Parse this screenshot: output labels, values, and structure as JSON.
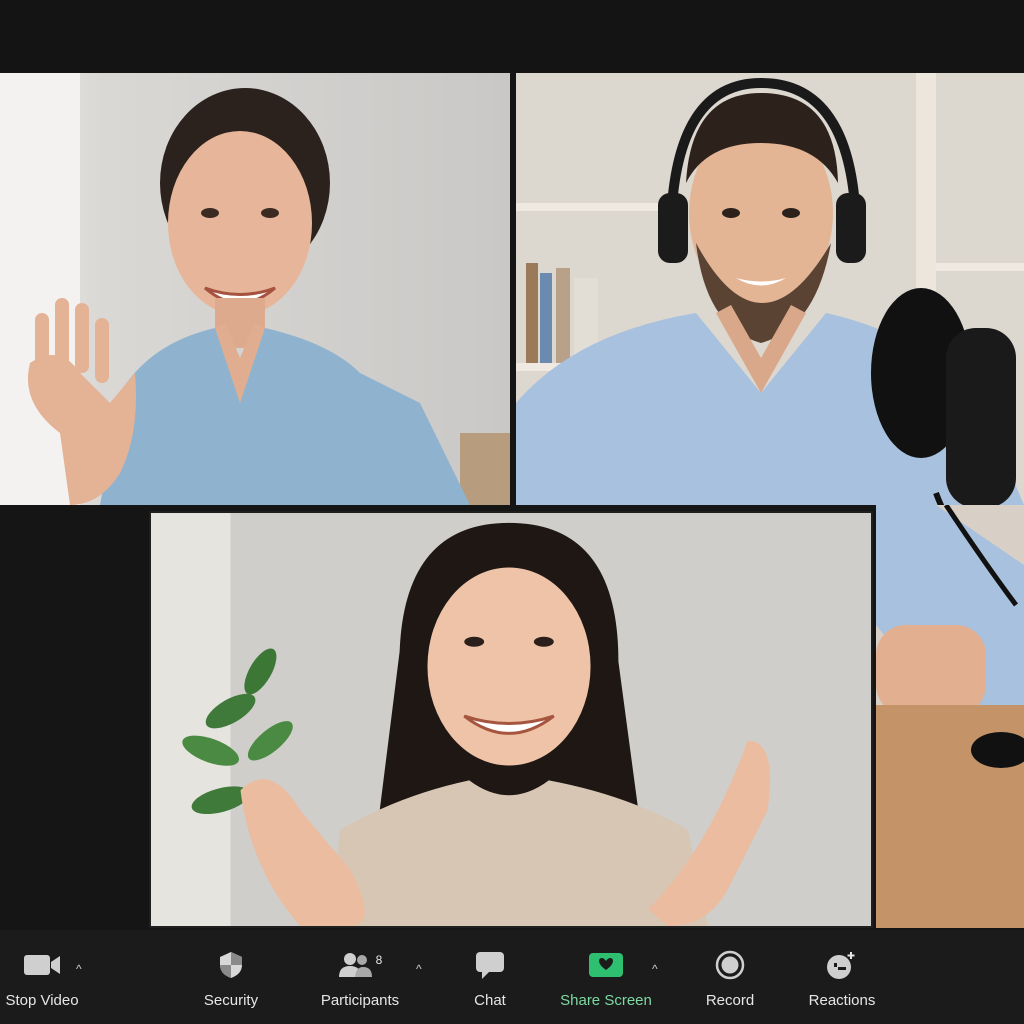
{
  "app": {
    "accent": "#2fbf71",
    "toolbar_bg": "#1b1b1b"
  },
  "participants": [
    {
      "tile": "top-left",
      "description": "woman waving, denim shirt"
    },
    {
      "tile": "top-right",
      "description": "man with headphones and microphone"
    },
    {
      "tile": "bottom-center",
      "description": "woman waving, beige sweater"
    }
  ],
  "toolbar": {
    "stop_video": {
      "label": "Stop Video",
      "icon": "video-camera-icon"
    },
    "security": {
      "label": "Security",
      "icon": "shield-icon"
    },
    "participants": {
      "label": "Participants",
      "icon": "people-icon",
      "count": "8"
    },
    "chat": {
      "label": "Chat",
      "icon": "chat-bubble-icon"
    },
    "share_screen": {
      "label": "Share Screen",
      "icon": "share-screen-icon",
      "color": "#7ed9a2"
    },
    "record": {
      "label": "Record",
      "icon": "record-icon"
    },
    "reactions": {
      "label": "Reactions",
      "icon": "reactions-icon"
    },
    "caret": "^"
  }
}
